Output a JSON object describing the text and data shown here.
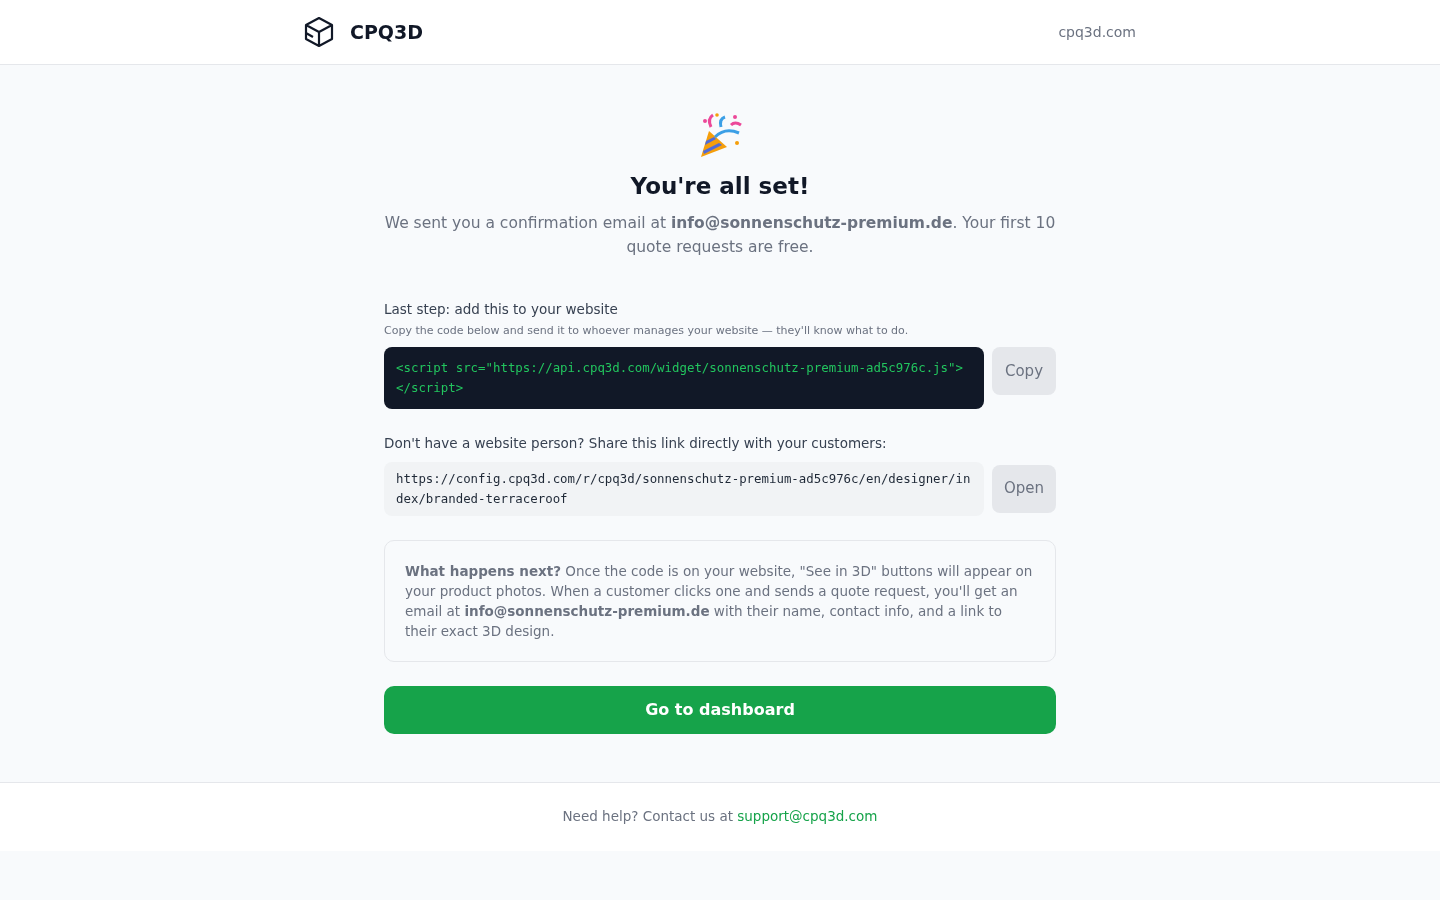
{
  "header": {
    "brand": "CPQ3D",
    "site_link": "cpq3d.com"
  },
  "hero": {
    "title": "You're all set!",
    "message": "We sent you a confirmation email at **info@sonnenschutz-premium.de**. Your first 10 quote requests are free."
  },
  "embed": {
    "label": "Last step: add this to your website",
    "hint": "Copy the code below and send it to whoever manages your website — they'll know what to do.",
    "code": "<script src=\"https://api.cpq3d.com/widget/sonnenschutz-premium-ad5c976c.js\"></script>",
    "button": "Copy"
  },
  "share": {
    "label": "Don't have a website person? Share this link directly with your customers:",
    "url": "https://config.cpq3d.com/r/cpq3d/sonnenschutz-premium-ad5c976c/en/designer/index/branded-terraceroof",
    "button": "Open"
  },
  "info": {
    "text": "**What happens next?** Once the code is on your website, \"See in 3D\" buttons will appear on your product photos. When a customer clicks one and sends a quote request, you'll get an email at **info@sonnenschutz-premium.de** with their name, contact info, and a link to their exact 3D design."
  },
  "cta": {
    "label": "Go to dashboard"
  },
  "footer": {
    "text": "Need help? Contact us at ",
    "link": "support@cpq3d.com"
  }
}
